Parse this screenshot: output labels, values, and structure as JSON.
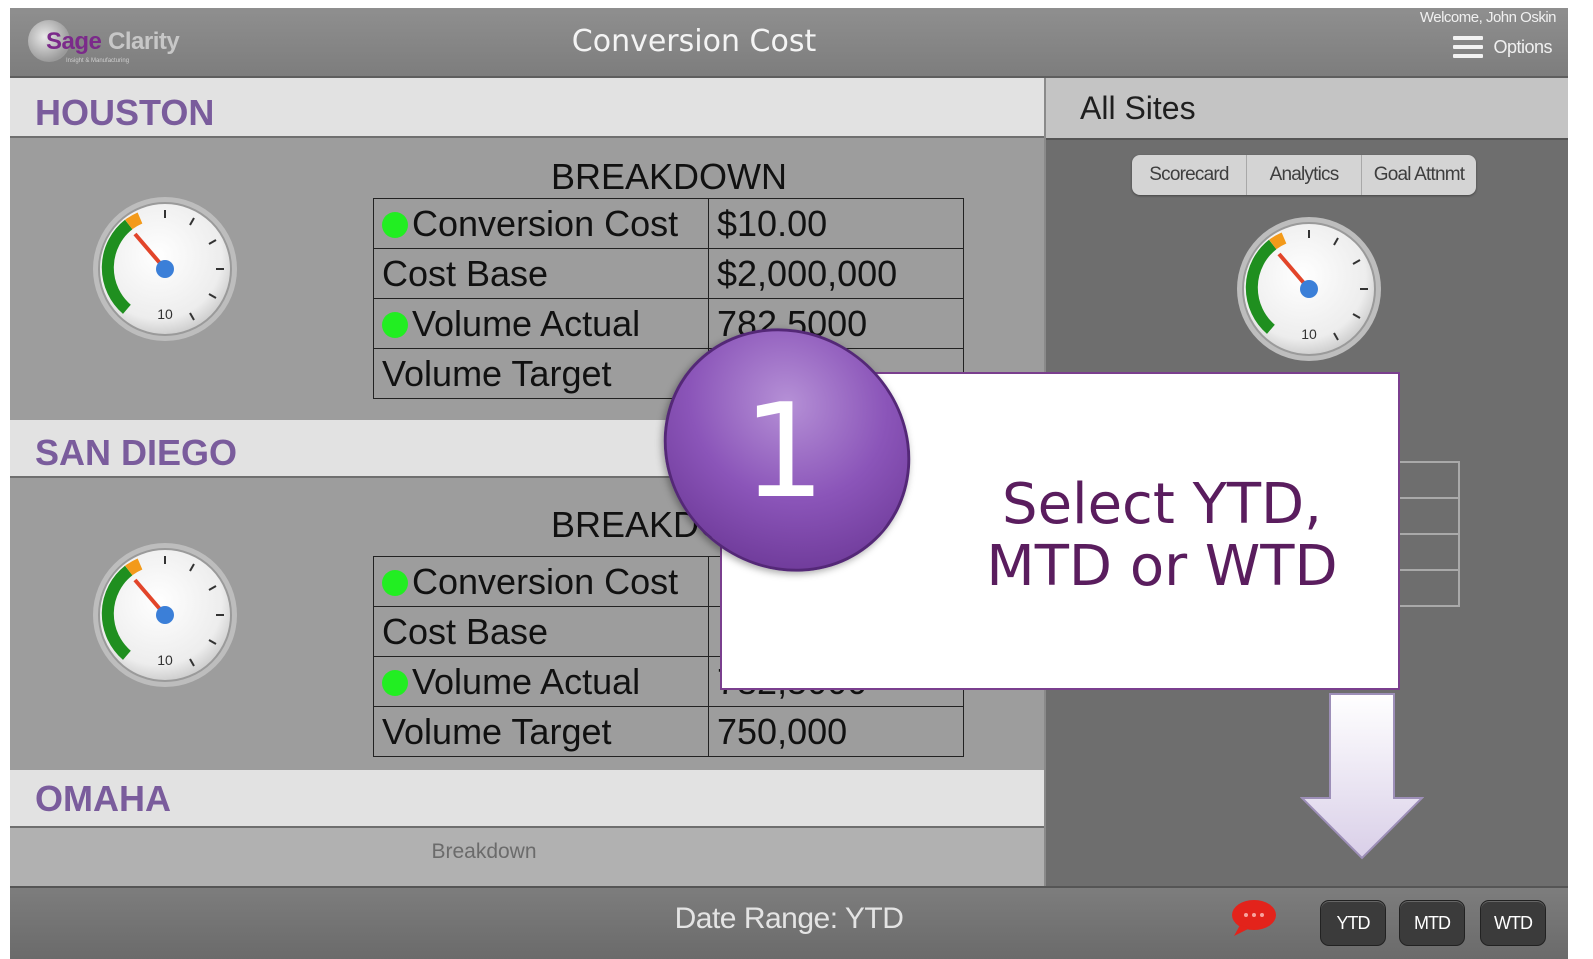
{
  "header": {
    "logo": {
      "brand_prefix": "Sage",
      "brand_suffix": "Clarity",
      "tagline": "Insight & Manufacturing"
    },
    "title": "Conversion Cost",
    "welcome": "Welcome, John Oskin",
    "options_label": "Options"
  },
  "sites": [
    {
      "name": "HOUSTON",
      "breakdown_title": "BREAKDOWN",
      "rows": [
        {
          "label": "Conversion Cost",
          "value": "$10.00",
          "status": "green"
        },
        {
          "label": "Cost Base",
          "value": "$2,000,000",
          "status": ""
        },
        {
          "label": "Volume Actual",
          "value": "782,5000",
          "status": "green"
        },
        {
          "label": "Volume Target",
          "value": "",
          "status": ""
        }
      ],
      "gauge_label": "10"
    },
    {
      "name": "SAN DIEGO",
      "breakdown_title": "BREAKDOWN",
      "rows": [
        {
          "label": "Conversion Cost",
          "value": "",
          "status": "green"
        },
        {
          "label": "Cost Base",
          "value": "",
          "status": ""
        },
        {
          "label": "Volume Actual",
          "value": "782,5000",
          "status": "green"
        },
        {
          "label": "Volume Target",
          "value": "750,000",
          "status": ""
        }
      ],
      "gauge_label": "10"
    },
    {
      "name": "OMAHA",
      "breakdown_title": "Breakdown"
    }
  ],
  "all_sites": {
    "title": "All Sites",
    "tabs": [
      "Scorecard",
      "Analytics",
      "Goal Attnmt"
    ],
    "gauge_label": "10"
  },
  "footer": {
    "date_range": "Date Range: YTD",
    "buttons": [
      "YTD",
      "MTD",
      "WTD"
    ]
  },
  "callout": {
    "step": "1",
    "line1": "Select YTD,",
    "line2": "MTD or WTD"
  },
  "colors": {
    "section_title": "#7a5c9c",
    "status_green": "#22ee22",
    "callout_purple": "#5a1d5e",
    "gauge_green": "#1f8f1f",
    "gauge_orange": "#f39a1a",
    "gauge_needle": "#e2452a",
    "gauge_hub": "#3b7fd8"
  }
}
